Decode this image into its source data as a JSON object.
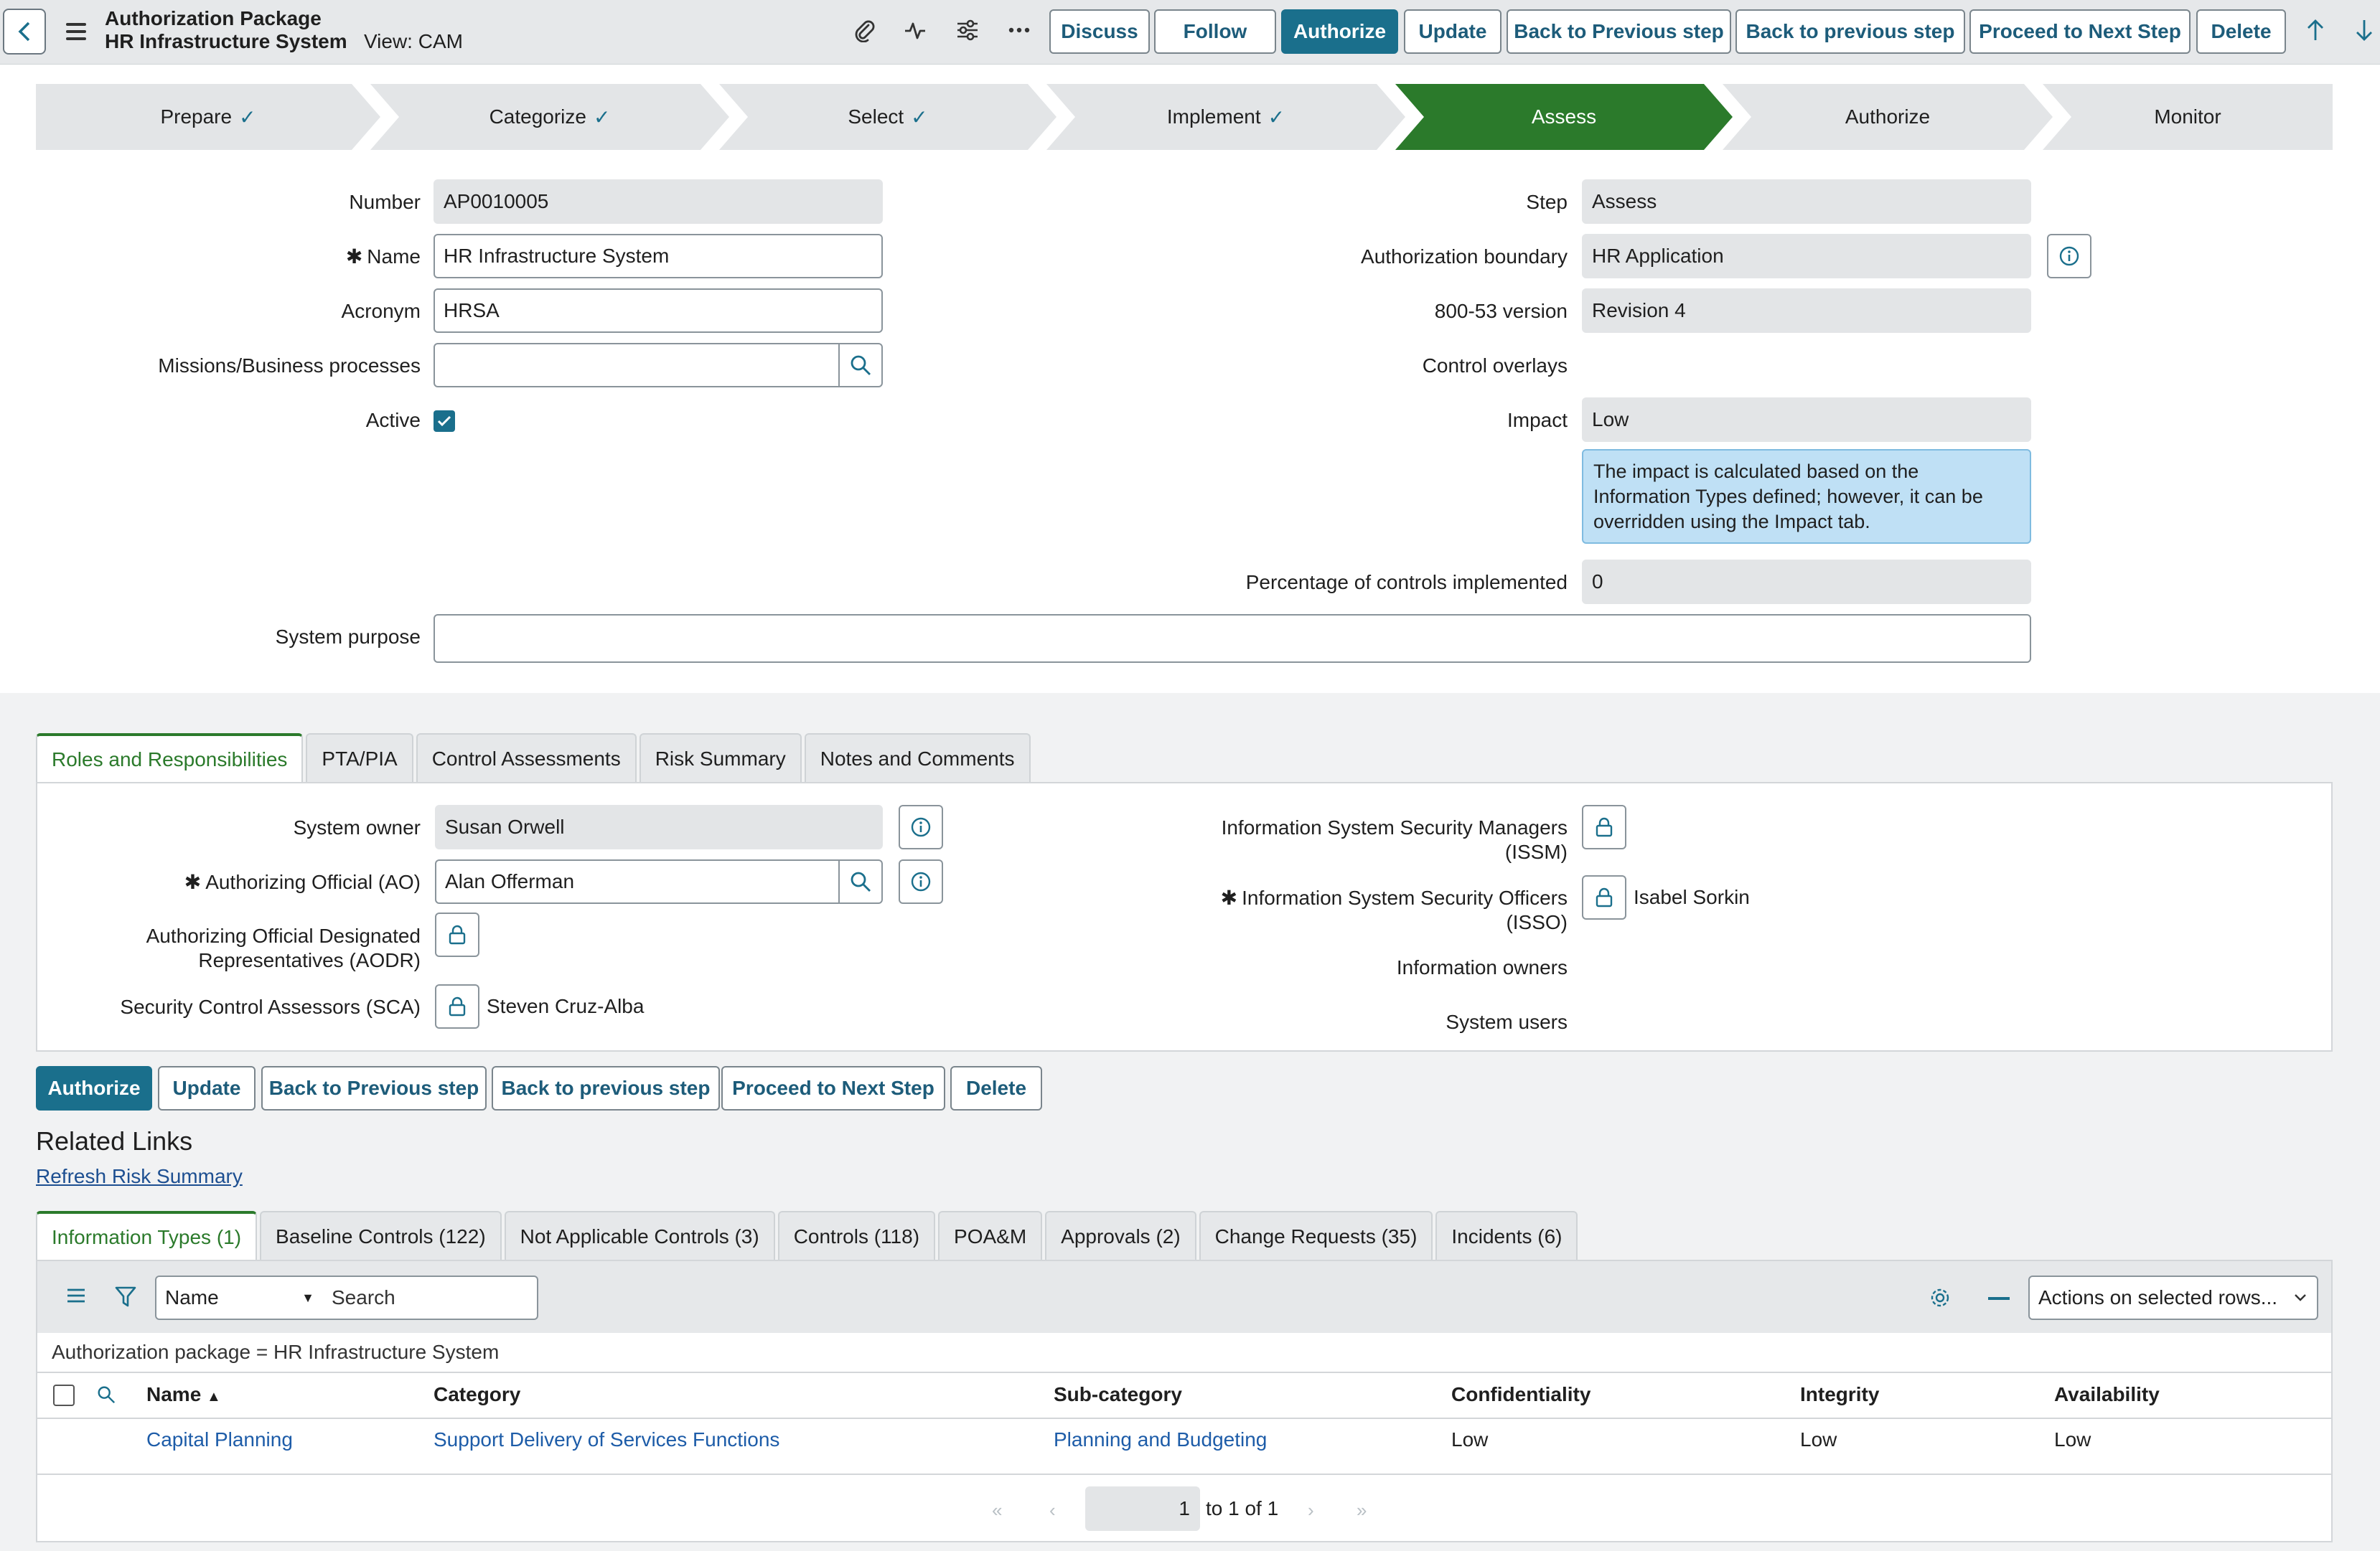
{
  "header": {
    "title": "Authorization Package",
    "record_name": "HR Infrastructure System",
    "view_label": "View: CAM",
    "buttons": {
      "discuss": "Discuss",
      "follow": "Follow",
      "authorize": "Authorize",
      "update": "Update",
      "back_prev_cap": "Back to Previous step",
      "back_prev": "Back to previous step",
      "proceed": "Proceed to Next Step",
      "delete": "Delete"
    },
    "icons": [
      "paperclip-icon",
      "activity-icon",
      "sliders-icon",
      "more-icon",
      "arrow-up-icon",
      "arrow-down-icon"
    ]
  },
  "stepper": {
    "steps": [
      {
        "label": "Prepare",
        "done": true
      },
      {
        "label": "Categorize",
        "done": true
      },
      {
        "label": "Select",
        "done": true
      },
      {
        "label": "Implement",
        "done": true
      },
      {
        "label": "Assess",
        "done": false,
        "active": true
      },
      {
        "label": "Authorize",
        "done": false
      },
      {
        "label": "Monitor",
        "done": false
      }
    ]
  },
  "form": {
    "number_label": "Number",
    "number": "AP0010005",
    "name_label": "Name",
    "name": "HR Infrastructure System",
    "acronym_label": "Acronym",
    "acronym": "HRSA",
    "missions_label": "Missions/Business processes",
    "missions": "",
    "active_label": "Active",
    "active": true,
    "step_label": "Step",
    "step": "Assess",
    "boundary_label": "Authorization boundary",
    "boundary": "HR Application",
    "version_label": "800-53 version",
    "version": "Revision 4",
    "overlays_label": "Control overlays",
    "impact_label": "Impact",
    "impact": "Low",
    "impact_note": "The impact is calculated based on the Information Types defined; however, it can be overridden using the Impact tab.",
    "pct_label": "Percentage of controls implemented",
    "pct": "0",
    "purpose_label": "System purpose",
    "purpose": ""
  },
  "section_tabs": [
    "Roles and Responsibilities",
    "PTA/PIA",
    "Control Assessments",
    "Risk Summary",
    "Notes and Comments"
  ],
  "roles": {
    "owner_label": "System owner",
    "owner": "Susan Orwell",
    "ao_label": "Authorizing Official (AO)",
    "ao": "Alan Offerman",
    "aodr_label_1": "Authorizing Official Designated",
    "aodr_label_2": "Representatives (AODR)",
    "sca_label": "Security Control Assessors (SCA)",
    "sca": "Steven Cruz-Alba",
    "issm_label_1": "Information System Security Managers",
    "issm_label_2": "(ISSM)",
    "isso_label_1": "Information System Security Officers",
    "isso_label_2": "(ISSO)",
    "isso": "Isabel Sorkin",
    "owners_label": "Information owners",
    "users_label": "System users"
  },
  "bottom_buttons": {
    "authorize": "Authorize",
    "update": "Update",
    "back_prev_cap": "Back to Previous step",
    "back_prev": "Back to previous step",
    "proceed": "Proceed to Next Step",
    "delete": "Delete"
  },
  "related": {
    "title": "Related Links",
    "refresh": "Refresh Risk Summary"
  },
  "related_tabs": [
    "Information Types (1)",
    "Baseline Controls (122)",
    "Not Applicable Controls (3)",
    "Controls (118)",
    "POA&M",
    "Approvals (2)",
    "Change Requests (35)",
    "Incidents (6)"
  ],
  "list": {
    "field_select": "Name",
    "search_placeholder": "Search",
    "actions": "Actions on selected rows...",
    "breadcrumb": "Authorization package = HR Infrastructure System",
    "columns": [
      "Name",
      "Category",
      "Sub-category",
      "Confidentiality",
      "Integrity",
      "Availability"
    ],
    "sort_indicator": "▲",
    "rows": [
      [
        "Capital Planning",
        "Support Delivery of Services Functions",
        "Planning and Budgeting",
        "Low",
        "Low",
        "Low"
      ]
    ],
    "pagination": {
      "current": "1",
      "suffix": "to 1 of 1"
    }
  }
}
